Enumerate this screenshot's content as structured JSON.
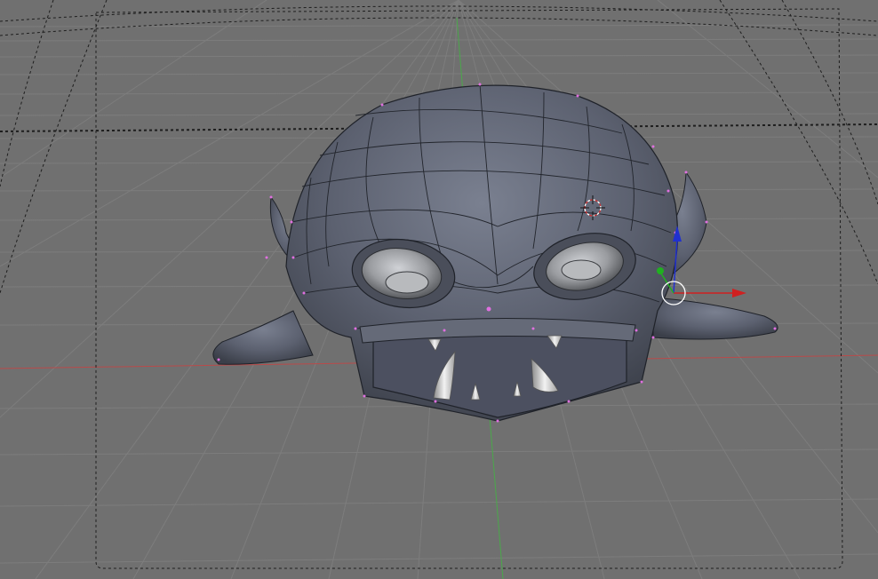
{
  "viewport": {
    "mode": "edit-mode",
    "view": "perspective",
    "background_color": "#707070",
    "grid_color": "#7c7c7c",
    "axis_x_color": "#c23a3a",
    "axis_y_color": "#3fae3f",
    "axis_z_color": "#2a3fd6",
    "mesh_color": "#5d6270",
    "mesh_wire_color": "#1f2229",
    "vertex_color": "#e070e0",
    "eye_color": "#9a9ca0",
    "tooth_color": "#e8e8e8"
  },
  "object": {
    "name": "",
    "icon": "monster-head-mesh"
  },
  "tools": {
    "manipulator": "translate-gizmo",
    "cursor": "3d-cursor-icon"
  }
}
